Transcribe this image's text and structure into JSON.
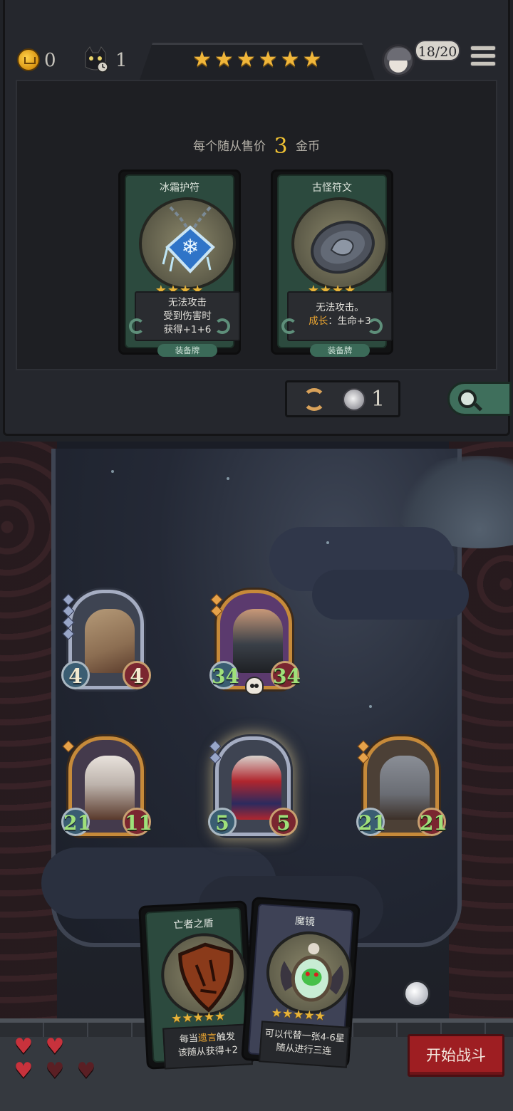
{
  "hud": {
    "gold": "0",
    "cat_count": "1",
    "tier_stars": [
      "★",
      "★",
      "★",
      "★",
      "★",
      "★"
    ],
    "lives": "18/20"
  },
  "shop": {
    "sell_prefix": "每个随从售价",
    "sell_price": "3",
    "sell_suffix": "金币",
    "cards": [
      {
        "name": "冰霜护符",
        "stars": "★★★★",
        "desc_line1": "无法攻击",
        "desc_line2": "受到伤害时",
        "desc_line3": "获得+1+6",
        "tag": "装备牌",
        "icon": "frost-amulet-icon"
      },
      {
        "name": "古怪符文",
        "stars": "★★★★",
        "desc_line1": "无法攻击。",
        "desc_kw": "成长",
        "desc_line2_rest": "：生命+3",
        "tag": "装备牌",
        "icon": "strange-rune-icon"
      }
    ],
    "refresh_cost": "1"
  },
  "board": {
    "minions": [
      {
        "atk": "4",
        "hp": "4"
      },
      {
        "atk": "34",
        "hp": "34"
      },
      {
        "atk": "21",
        "hp": "11"
      },
      {
        "atk": "5",
        "hp": "5"
      },
      {
        "atk": "21",
        "hp": "21"
      }
    ]
  },
  "hand": [
    {
      "name": "亡者之盾",
      "stars": "★★★★★",
      "desc_pre": "每当",
      "desc_kw": "遗言",
      "desc_post": "触发",
      "desc_line2": "该随从获得+2"
    },
    {
      "name": "魔镜",
      "stars": "★★★★★",
      "desc_line1": "可以代替一张4-6星",
      "desc_line2": "随从进行三连"
    }
  ],
  "player": {
    "hearts": [
      "full",
      "full",
      "full",
      "empty",
      "empty"
    ]
  },
  "actions": {
    "start_battle": "开始战斗"
  },
  "colors": {
    "gold": "#f0b63a",
    "start_button": "#9e1e22",
    "card_plate": "#2c4a3e"
  }
}
